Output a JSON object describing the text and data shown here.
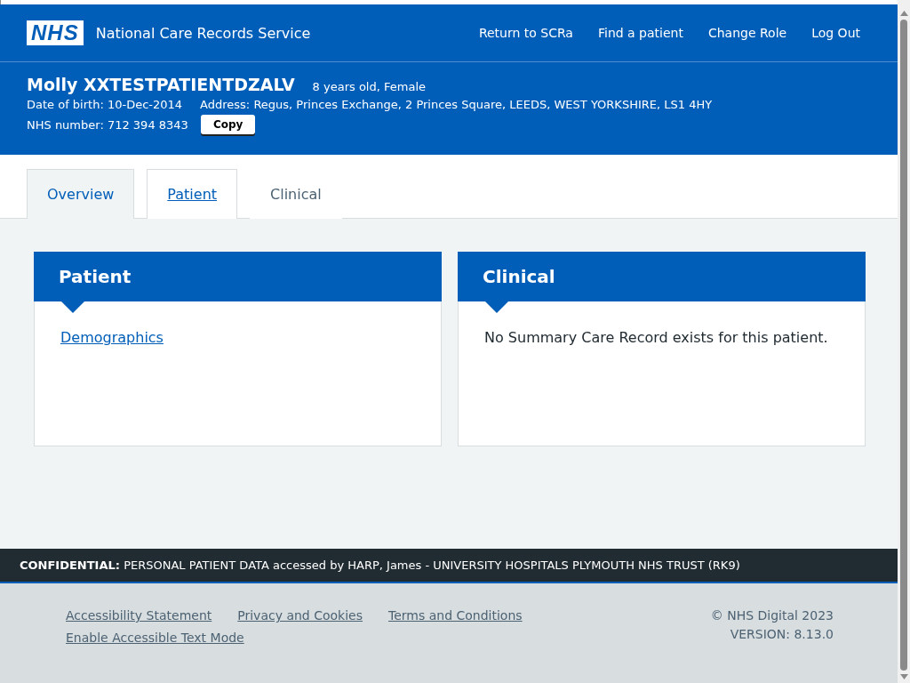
{
  "header": {
    "logo": "NHS",
    "service_name": "National Care Records Service",
    "nav": [
      "Return to SCRa",
      "Find a patient",
      "Change Role",
      "Log Out"
    ]
  },
  "patient_banner": {
    "name": "Molly XXTESTPATIENTDZALV",
    "age_gender": "8 years old, Female",
    "dob": "Date of birth: 10-Dec-2014",
    "address": "Address: Regus, Princes Exchange, 2 Princes Square, LEEDS, WEST YORKSHIRE, LS1 4HY",
    "nhs_number": "NHS number: 712 394 8343",
    "copy_button": "Copy"
  },
  "tabs": [
    {
      "label": "Overview",
      "selected": true,
      "kind": "link"
    },
    {
      "label": "Patient",
      "selected": false,
      "kind": "link"
    },
    {
      "label": "Clinical",
      "selected": false,
      "kind": "plain"
    }
  ],
  "cards": [
    {
      "title": "Patient",
      "kind": "link",
      "content": "Demographics"
    },
    {
      "title": "Clinical",
      "kind": "text",
      "content": "No Summary Care Record exists for this patient."
    }
  ],
  "confidential_bar": "**CONFIDENTIAL:** PERSONAL PATIENT DATA accessed by HARP, James - UNIVERSITY HOSPITALS PLYMOUTH NHS TRUST (RK9)",
  "footer": {
    "links": [
      "Accessibility Statement",
      "Privacy and Cookies",
      "Terms and Conditions"
    ],
    "second_row_links": [
      "Enable Accessible Text Mode"
    ],
    "copyright": "© NHS Digital 2023",
    "version": "VERSION: 8.13.0"
  }
}
